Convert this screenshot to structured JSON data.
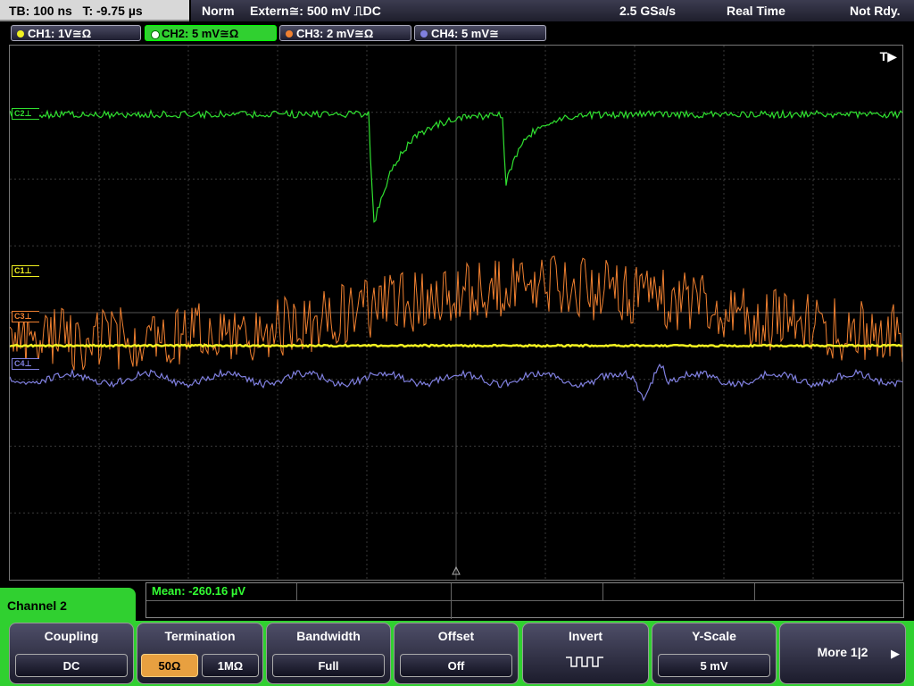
{
  "topbar": {
    "timebase": "TB: 100 ns   T: -9.75 µs",
    "mode": "Norm",
    "trigger": "Extern≅: 500 mV ⎍DC",
    "sample_rate": "2.5 GSa/s",
    "acq_mode": "Real Time",
    "state": "Not Rdy."
  },
  "channels": [
    {
      "label": "CH1: 1V≅Ω",
      "color": "#f0f020"
    },
    {
      "label": "CH2: 5 mV≅Ω",
      "color": "#30e030"
    },
    {
      "label": "CH3: 2 mV≅Ω",
      "color": "#f08030"
    },
    {
      "label": "CH4: 5 mV≅",
      "color": "#8080e0"
    }
  ],
  "screen": {
    "trigger_marker": "T▶",
    "markers": [
      "C1⊥",
      "C3⊥",
      "C4⊥",
      "C2⊥"
    ]
  },
  "measurement": {
    "mean": "Mean: -260.16 µV"
  },
  "menu": {
    "channel": "Channel 2",
    "coupling": {
      "title": "Coupling",
      "value": "DC"
    },
    "termination": {
      "title": "Termination",
      "opt1": "50Ω",
      "opt2": "1MΩ"
    },
    "bandwidth": {
      "title": "Bandwidth",
      "value": "Full"
    },
    "offset": {
      "title": "Offset",
      "value": "Off"
    },
    "invert": {
      "title": "Invert"
    },
    "yscale": {
      "title": "Y-Scale",
      "value": "5 mV"
    },
    "more": {
      "label": "More 1|2"
    }
  }
}
